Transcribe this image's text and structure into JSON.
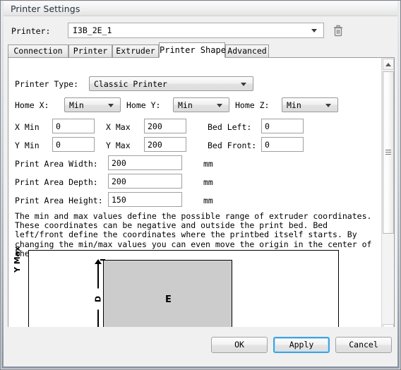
{
  "window": {
    "title": "Printer Settings"
  },
  "printer_row": {
    "label": "Printer:",
    "value": "I3B_2E_1",
    "delete_icon": "trash-icon"
  },
  "tabs": [
    {
      "label": "Connection",
      "active": false
    },
    {
      "label": "Printer",
      "active": false
    },
    {
      "label": "Extruder",
      "active": false
    },
    {
      "label": "Printer Shape",
      "active": true
    },
    {
      "label": "Advanced",
      "active": false
    }
  ],
  "form": {
    "printer_type": {
      "label": "Printer Type:",
      "value": "Classic Printer"
    },
    "home_x": {
      "label": "Home X:",
      "value": "Min"
    },
    "home_y": {
      "label": "Home Y:",
      "value": "Min"
    },
    "home_z": {
      "label": "Home Z:",
      "value": "Min"
    },
    "x_min": {
      "label": "X Min",
      "value": "0"
    },
    "x_max": {
      "label": "X Max",
      "value": "200"
    },
    "bed_left": {
      "label": "Bed Left:",
      "value": "0"
    },
    "y_min": {
      "label": "Y Min",
      "value": "0"
    },
    "y_max": {
      "label": "Y Max",
      "value": "200"
    },
    "bed_front": {
      "label": "Bed Front:",
      "value": "0"
    },
    "print_area_width": {
      "label": "Print Area Width:",
      "value": "200",
      "unit": "mm"
    },
    "print_area_depth": {
      "label": "Print Area Depth:",
      "value": "200",
      "unit": "mm"
    },
    "print_area_height": {
      "label": "Print Area Height:",
      "value": "150",
      "unit": "mm"
    }
  },
  "description": "The min and max values define the possible range of extruder coordinates.\nThese coordinates can be negative and outside the print bed. Bed\nleft/front define the coordinates where the printbed itself starts. By\nchanging the min/max values you can even move the origin in the center of\nthe print bed, if supported by firmware.",
  "diagram": {
    "y_max_label": "Y Max",
    "depth_label": "D",
    "bed_label": "E"
  },
  "scrollbar": {
    "up_icon": "chevron-up-icon",
    "down_icon": "chevron-down-icon"
  },
  "buttons": {
    "ok": "OK",
    "apply": "Apply",
    "cancel": "Cancel"
  }
}
